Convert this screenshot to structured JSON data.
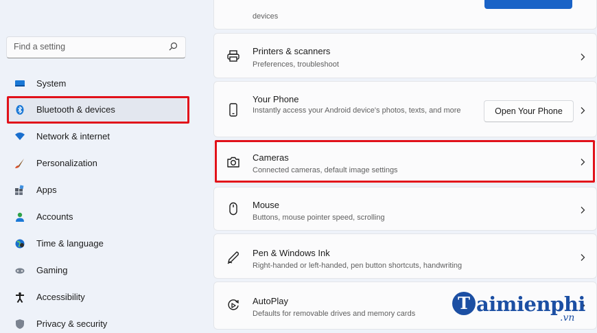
{
  "search": {
    "placeholder": "Find a setting"
  },
  "sidebar": {
    "items": [
      {
        "label": "System",
        "icon": "monitor-icon"
      },
      {
        "label": "Bluetooth & devices",
        "icon": "bluetooth-icon"
      },
      {
        "label": "Network & internet",
        "icon": "wifi-icon"
      },
      {
        "label": "Personalization",
        "icon": "brush-icon"
      },
      {
        "label": "Apps",
        "icon": "apps-icon"
      },
      {
        "label": "Accounts",
        "icon": "person-icon"
      },
      {
        "label": "Time & language",
        "icon": "globe-clock-icon"
      },
      {
        "label": "Gaming",
        "icon": "gamepad-icon"
      },
      {
        "label": "Accessibility",
        "icon": "accessibility-icon"
      },
      {
        "label": "Privacy & security",
        "icon": "shield-icon"
      }
    ]
  },
  "main": {
    "top_card": {
      "desc": "devices"
    },
    "cards": [
      {
        "title": "Printers & scanners",
        "desc": "Preferences, troubleshoot",
        "icon": "printer-icon"
      },
      {
        "title": "Your Phone",
        "desc": "Instantly access your Android device's photos, texts, and more",
        "icon": "phone-icon",
        "button": "Open Your Phone"
      },
      {
        "title": "Cameras",
        "desc": "Connected cameras, default image settings",
        "icon": "camera-icon"
      },
      {
        "title": "Mouse",
        "desc": "Buttons, mouse pointer speed, scrolling",
        "icon": "mouse-icon"
      },
      {
        "title": "Pen & Windows Ink",
        "desc": "Right-handed or left-handed, pen button shortcuts, handwriting",
        "icon": "pen-icon"
      },
      {
        "title": "AutoPlay",
        "desc": "Defaults for removable drives and memory cards",
        "icon": "autoplay-icon"
      }
    ]
  },
  "watermark": {
    "text": "aimienphi",
    "suffix": ".vn",
    "initial": "T"
  },
  "colors": {
    "highlight": "#e1111a",
    "accent": "#1a63c7",
    "watermark": "#1c4fa3"
  }
}
